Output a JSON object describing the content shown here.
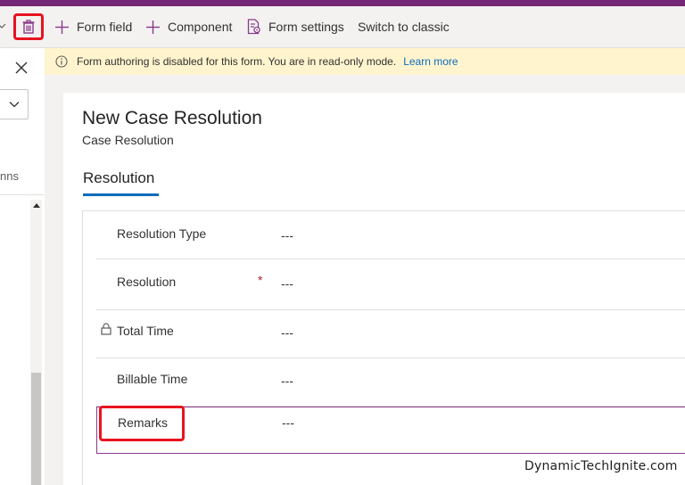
{
  "toolbar": {
    "delete_icon": "trash-icon",
    "items": [
      {
        "label": "Form field",
        "icon": "plus-icon"
      },
      {
        "label": "Component",
        "icon": "plus-icon"
      },
      {
        "label": "Form settings",
        "icon": "form-settings-icon"
      },
      {
        "label": "Switch to classic"
      }
    ]
  },
  "left_pane": {
    "label": "nns"
  },
  "infobar": {
    "message": "Form authoring is disabled for this form. You are in read-only mode.",
    "link": "Learn more"
  },
  "form": {
    "title": "New Case Resolution",
    "subtitle": "Case Resolution",
    "tab": "Resolution",
    "fields": [
      {
        "label": "Resolution Type",
        "value": "---"
      },
      {
        "label": "Resolution",
        "value": "---",
        "required_mark": "*"
      },
      {
        "label": "Total Time",
        "value": "---",
        "icon": "lock-icon"
      },
      {
        "label": "Billable Time",
        "value": "---"
      },
      {
        "label": "Remarks",
        "value": "---"
      }
    ]
  },
  "watermark": "DynamicTechIgnite.com",
  "colors": {
    "brand_stripe": "#742774",
    "highlight": "#e8131f",
    "tab_underline": "#0f6cbd",
    "info_bg": "#fff4ce"
  }
}
